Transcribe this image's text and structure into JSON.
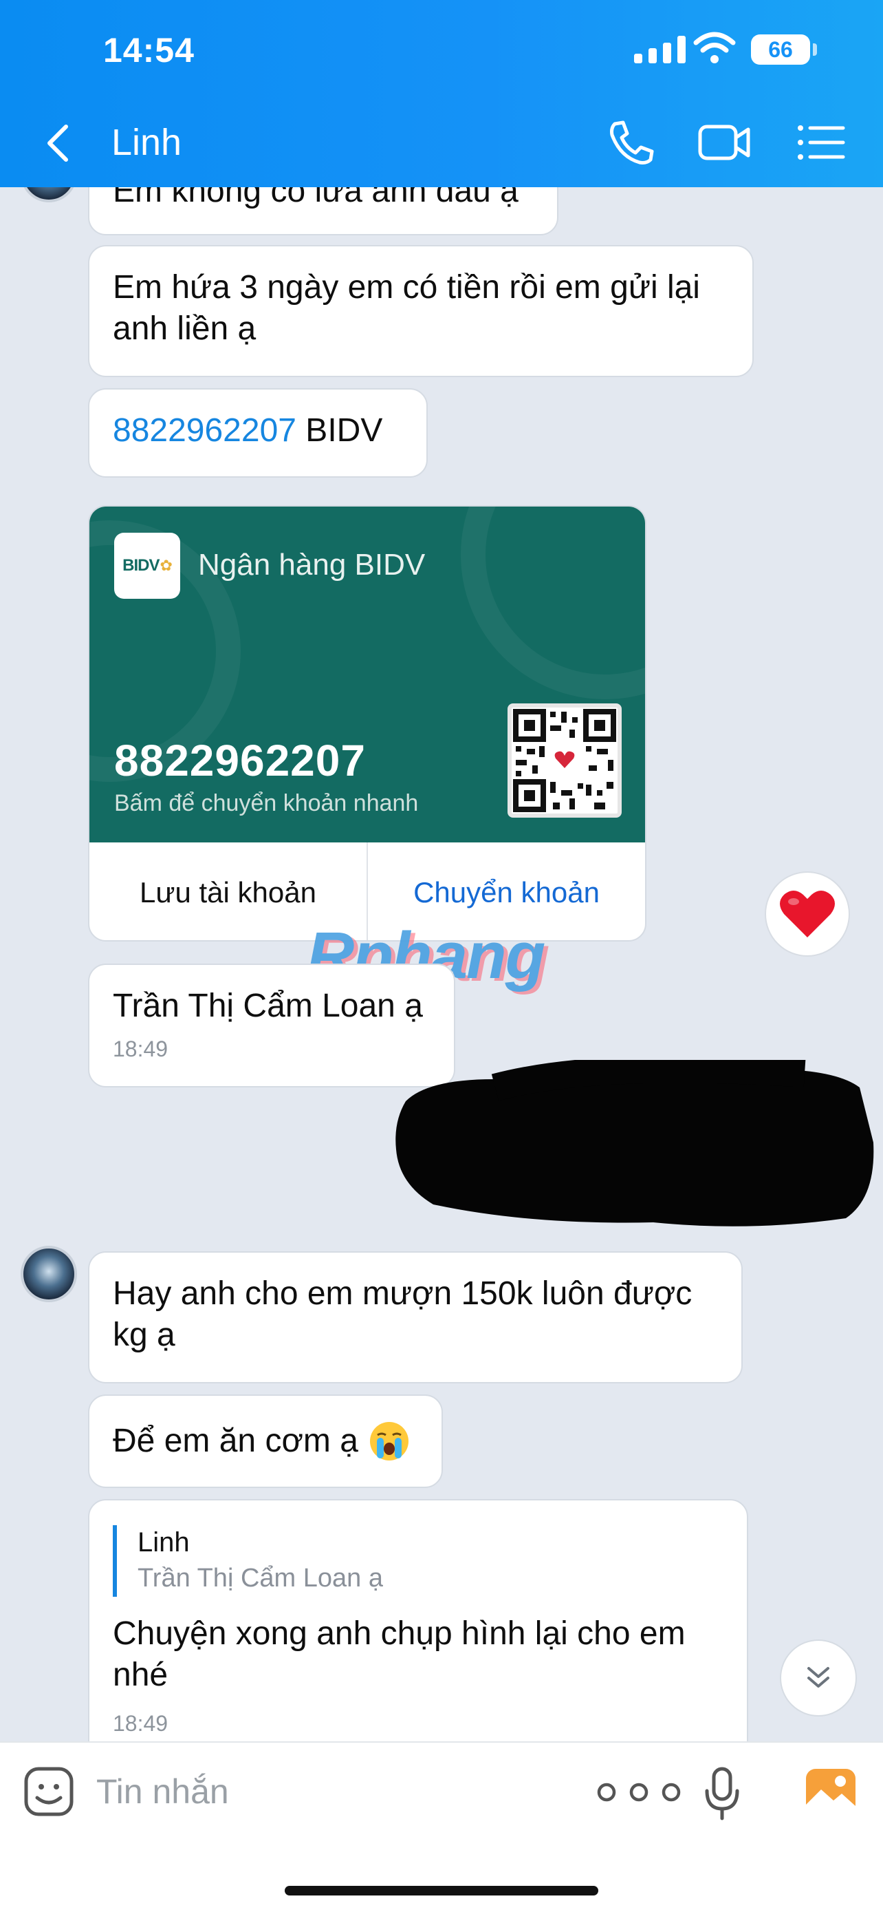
{
  "status_bar": {
    "time": "14:54",
    "battery": "66"
  },
  "header": {
    "title": "Linh"
  },
  "messages": {
    "m1": "Em không có lừa anh đâu ạ",
    "m2": "Em hứa 3 ngày em có tiền rồi em gửi lại anh liền ạ",
    "m3_number": "8822962207",
    "m3_bank": "BIDV",
    "m5_text": "Trần Thị Cẩm Loan ạ",
    "m5_time": "18:49",
    "m6": "Hay anh cho em mượn 150k luôn được kg ạ",
    "m7": "Để em ăn cơm ạ",
    "m8_quote_name": "Linh",
    "m8_quote_text": "Trần Thị Cẩm Loan ạ",
    "m8_text": "Chuyện xong anh chụp hình lại cho em nhé",
    "m8_time": "18:49"
  },
  "bank_card": {
    "logo_text": "BIDV",
    "bank_name": "Ngân hàng BIDV",
    "account_number": "8822962207",
    "hint": "Bấm để chuyển khoản nhanh",
    "save_label": "Lưu tài khoản",
    "transfer_label": "Chuyển khoản"
  },
  "watermark": "Rphang",
  "composer": {
    "placeholder": "Tin nhắn"
  },
  "icons": [
    "back-arrow-icon",
    "phone-icon",
    "video-call-icon",
    "menu-list-icon",
    "heart-icon",
    "sticker-icon",
    "more-icon",
    "microphone-icon",
    "photo-icon",
    "chevron-down-icon",
    "qr-code-icon"
  ],
  "colors": {
    "header": "#1592F7",
    "link": "#1686E0",
    "card_bg": "#136B62",
    "transfer": "#1469D4"
  }
}
